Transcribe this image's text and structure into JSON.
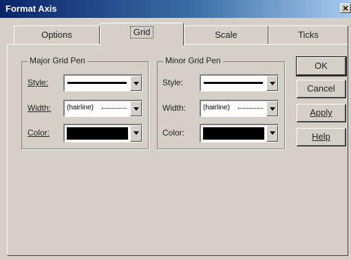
{
  "window": {
    "title": "Format Axis",
    "close_glyph": "✕"
  },
  "tabs": [
    {
      "label": "Options",
      "active": false
    },
    {
      "label": "Grid",
      "active": true
    },
    {
      "label": "Scale",
      "active": false
    },
    {
      "label": "Ticks",
      "active": false
    }
  ],
  "major_grid": {
    "legend": "Major Grid Pen",
    "style_label": "Style:",
    "width_label": "Width:",
    "width_value": "(hairline)",
    "color_label": "Color:",
    "color_value": "#000000"
  },
  "minor_grid": {
    "legend": "Minor Grid Pen",
    "style_label": "Style:",
    "width_label": "Width:",
    "width_value": "(hairline)",
    "color_label": "Color:",
    "color_value": "#000000"
  },
  "buttons": {
    "ok": "OK",
    "cancel": "Cancel",
    "apply": "Apply",
    "help": "Help"
  },
  "colors": {
    "title_gradient_start": "#0a246a",
    "dialog_bg": "#d4d0c8"
  }
}
